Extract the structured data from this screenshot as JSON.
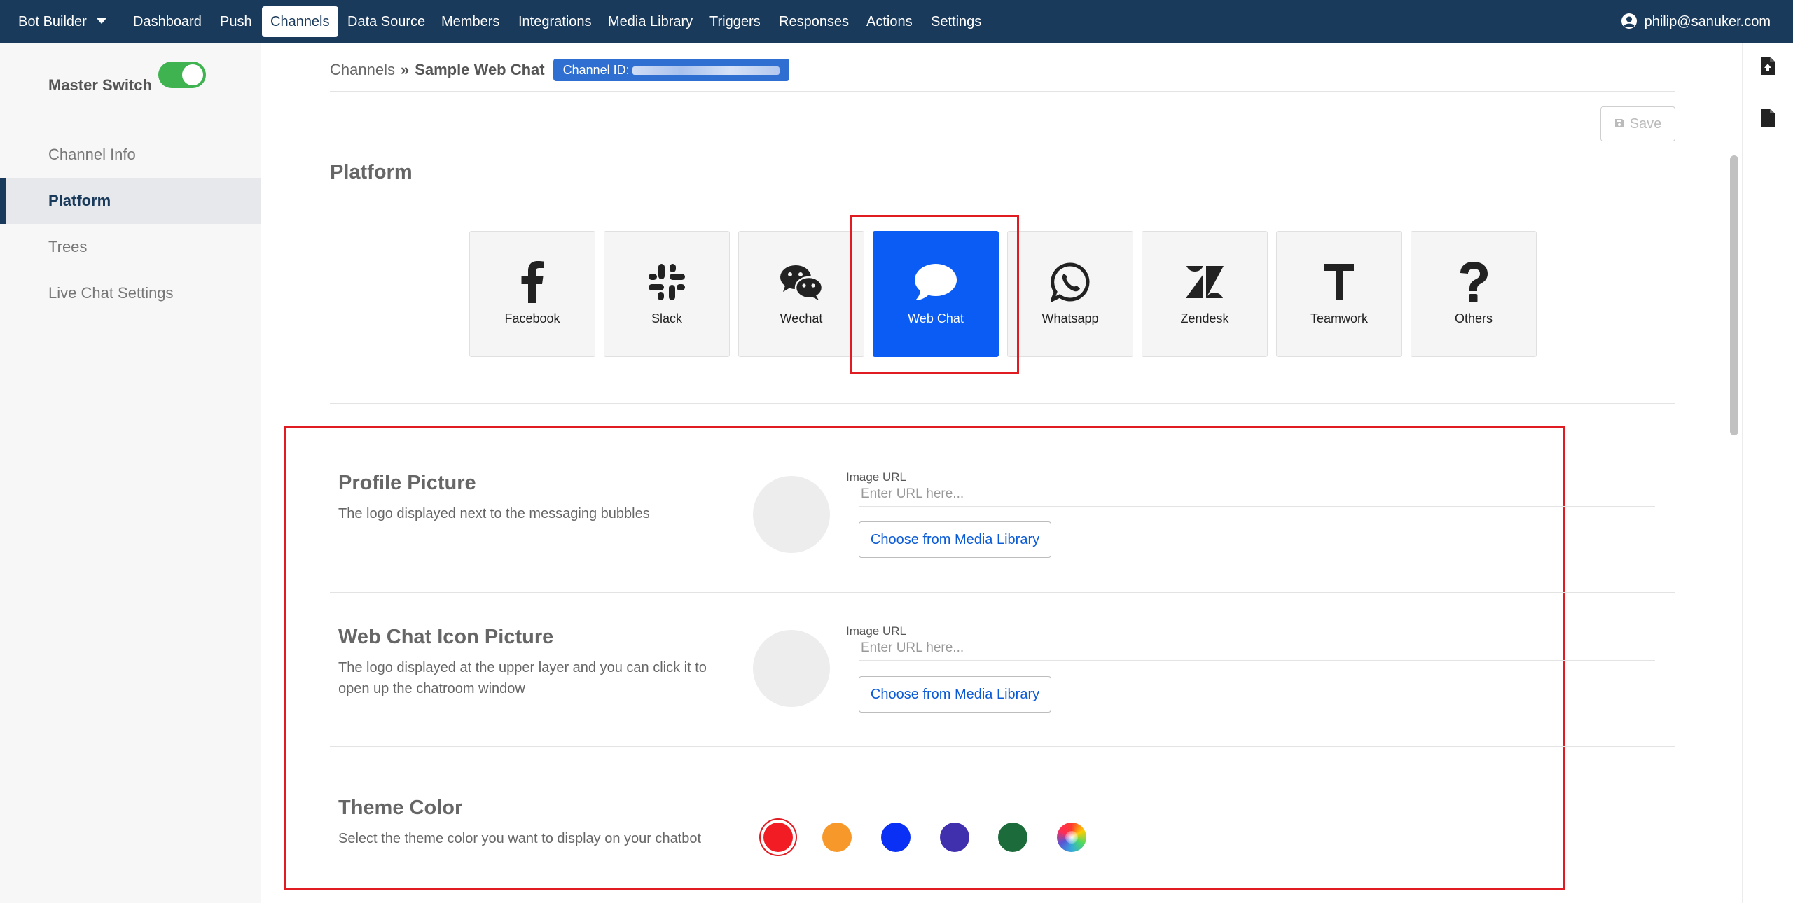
{
  "topnav": {
    "brand": "Bot Builder",
    "items": [
      {
        "label": "Dashboard",
        "active": false
      },
      {
        "label": "Push",
        "active": false
      },
      {
        "label": "Channels",
        "active": true
      },
      {
        "label": "Data Source",
        "active": false
      },
      {
        "label": "Members",
        "active": false
      },
      {
        "label": "Integrations",
        "active": false
      },
      {
        "label": "Media Library",
        "active": false
      },
      {
        "label": "Triggers",
        "active": false
      },
      {
        "label": "Responses",
        "active": false
      },
      {
        "label": "Actions",
        "active": false
      },
      {
        "label": "Settings",
        "active": false
      }
    ],
    "user_email": "philip@sanuker.com"
  },
  "sidebar": {
    "master_switch_label": "Master Switch",
    "master_switch_on": true,
    "items": [
      {
        "label": "Channel Info",
        "active": false
      },
      {
        "label": "Platform",
        "active": true
      },
      {
        "label": "Trees",
        "active": false
      },
      {
        "label": "Live Chat Settings",
        "active": false
      }
    ]
  },
  "breadcrumb": {
    "root": "Channels",
    "current": "Sample Web Chat",
    "channel_id_label": "Channel ID:"
  },
  "toolbar": {
    "save_label": "Save"
  },
  "platform": {
    "title": "Platform",
    "selected": "Web Chat",
    "options": [
      {
        "label": "Facebook",
        "icon": "facebook-icon"
      },
      {
        "label": "Slack",
        "icon": "slack-icon"
      },
      {
        "label": "Wechat",
        "icon": "wechat-icon"
      },
      {
        "label": "Web Chat",
        "icon": "chat-bubble-icon"
      },
      {
        "label": "Whatsapp",
        "icon": "whatsapp-icon"
      },
      {
        "label": "Zendesk",
        "icon": "zendesk-icon"
      },
      {
        "label": "Teamwork",
        "icon": "teamwork-icon"
      },
      {
        "label": "Others",
        "icon": "question-icon"
      }
    ]
  },
  "profile_picture": {
    "title": "Profile Picture",
    "description": "The logo displayed next to the messaging bubbles",
    "url_label": "Image URL",
    "url_placeholder": "Enter URL here...",
    "url_value": "",
    "media_button": "Choose from Media Library"
  },
  "icon_picture": {
    "title": "Web Chat Icon Picture",
    "description": "The logo displayed at the upper layer and you can click it to open up the chatroom window",
    "url_label": "Image URL",
    "url_placeholder": "Enter URL here...",
    "url_value": "",
    "media_button": "Choose from Media Library"
  },
  "theme_color": {
    "title": "Theme Color",
    "description": "Select the theme color you want to display on your chatbot",
    "selected_index": 0,
    "swatches": [
      "#f11c24",
      "#f7982a",
      "#0a2ff5",
      "#4130ad",
      "#1c6b3a",
      "custom-picker"
    ]
  },
  "colors": {
    "nav_bg": "#1a3a5b",
    "accent_blue": "#0b5cf4",
    "toggle_green": "#3fb34f",
    "highlight_red": "#e01b22"
  }
}
